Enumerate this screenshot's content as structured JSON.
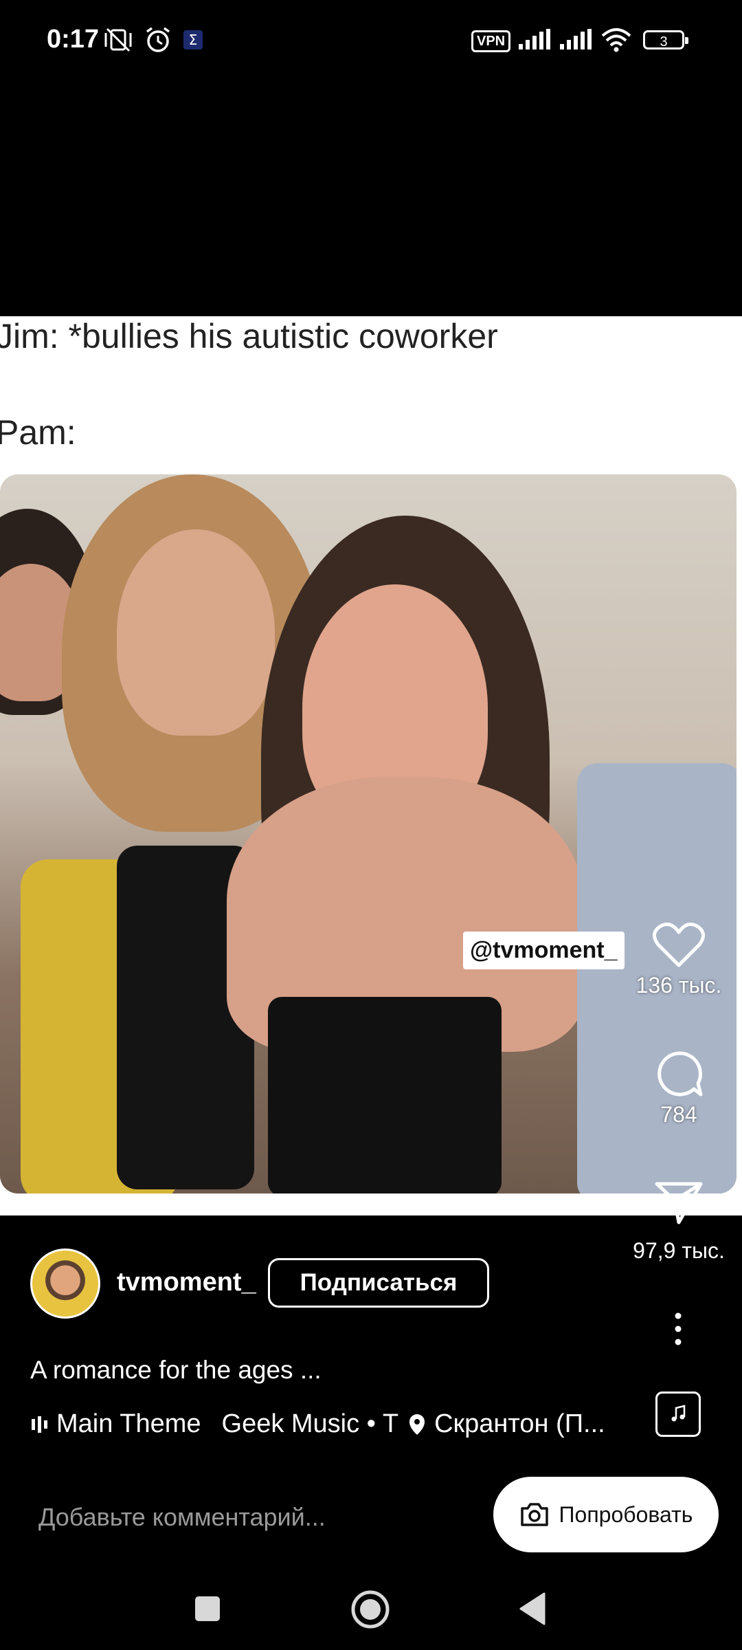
{
  "status_bar": {
    "time": "0:17",
    "icons": [
      "mute-vibrate-icon",
      "alarm-icon",
      "sigma-icon",
      "vpn-icon",
      "signal-icon",
      "signal-icon",
      "wifi-icon",
      "battery-icon"
    ],
    "vpn_label": "VPN",
    "battery_level": "3"
  },
  "post": {
    "caption_lines": [
      "Jim: *bullies his autistic coworker",
      "Pam:"
    ],
    "watermark_tag": "@tvmoment_",
    "likes": "136 тыс.",
    "comments": "784",
    "shares": "97,9 тыс.",
    "username": "tvmoment_",
    "follow_label": "Подписаться",
    "description": "A romance for the ages ...",
    "music": "Main Theme",
    "music_artist": "Geek Music • T",
    "location": "Скрантон (П..."
  },
  "comment_bar": {
    "placeholder": "Добавьте комментарий...",
    "try_label": "Попробовать"
  },
  "colors": {
    "background": "#000000",
    "text": "#ffffff",
    "muted": "#9a9a9a"
  }
}
